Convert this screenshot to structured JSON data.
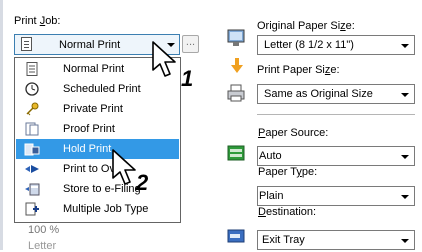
{
  "left": {
    "print_job_label": "Print Job:",
    "selected_value": "Normal Print",
    "dots_button": "...",
    "options": [
      {
        "label": "Normal Print",
        "icon": "page-icon"
      },
      {
        "label": "Scheduled Print",
        "icon": "clock-icon"
      },
      {
        "label": "Private Print",
        "icon": "key-icon"
      },
      {
        "label": "Proof Print",
        "icon": "proof-icon"
      },
      {
        "label": "Hold Print",
        "icon": "hold-icon",
        "selected": true
      },
      {
        "label": "Print to Ov",
        "icon": "overlay-icon"
      },
      {
        "label": "Store to e-Filing",
        "icon": "efiling-icon"
      },
      {
        "label": "Multiple Job Type",
        "icon": "multiple-job-icon"
      }
    ],
    "behind_value": "100 %",
    "behind_value2": "Letter"
  },
  "right": {
    "original_paper_size_label": "Original Paper Size:",
    "original_paper_size_value": "Letter (8 1/2 x 11\")",
    "print_paper_size_label": "Print Paper Size:",
    "print_paper_size_value": "Same as Original Size",
    "paper_source_label": "Paper Source:",
    "paper_source_value": "Auto",
    "paper_type_label": "Paper Type:",
    "paper_type_value": "Plain",
    "destination_label": "Destination:",
    "destination_value": "Exit Tray"
  },
  "callouts": {
    "step1": "1",
    "step2": "2"
  },
  "colors": {
    "selection": "#3399e6",
    "combo_border": "#3c7fb1",
    "combo_bg": "#eef5fb"
  }
}
